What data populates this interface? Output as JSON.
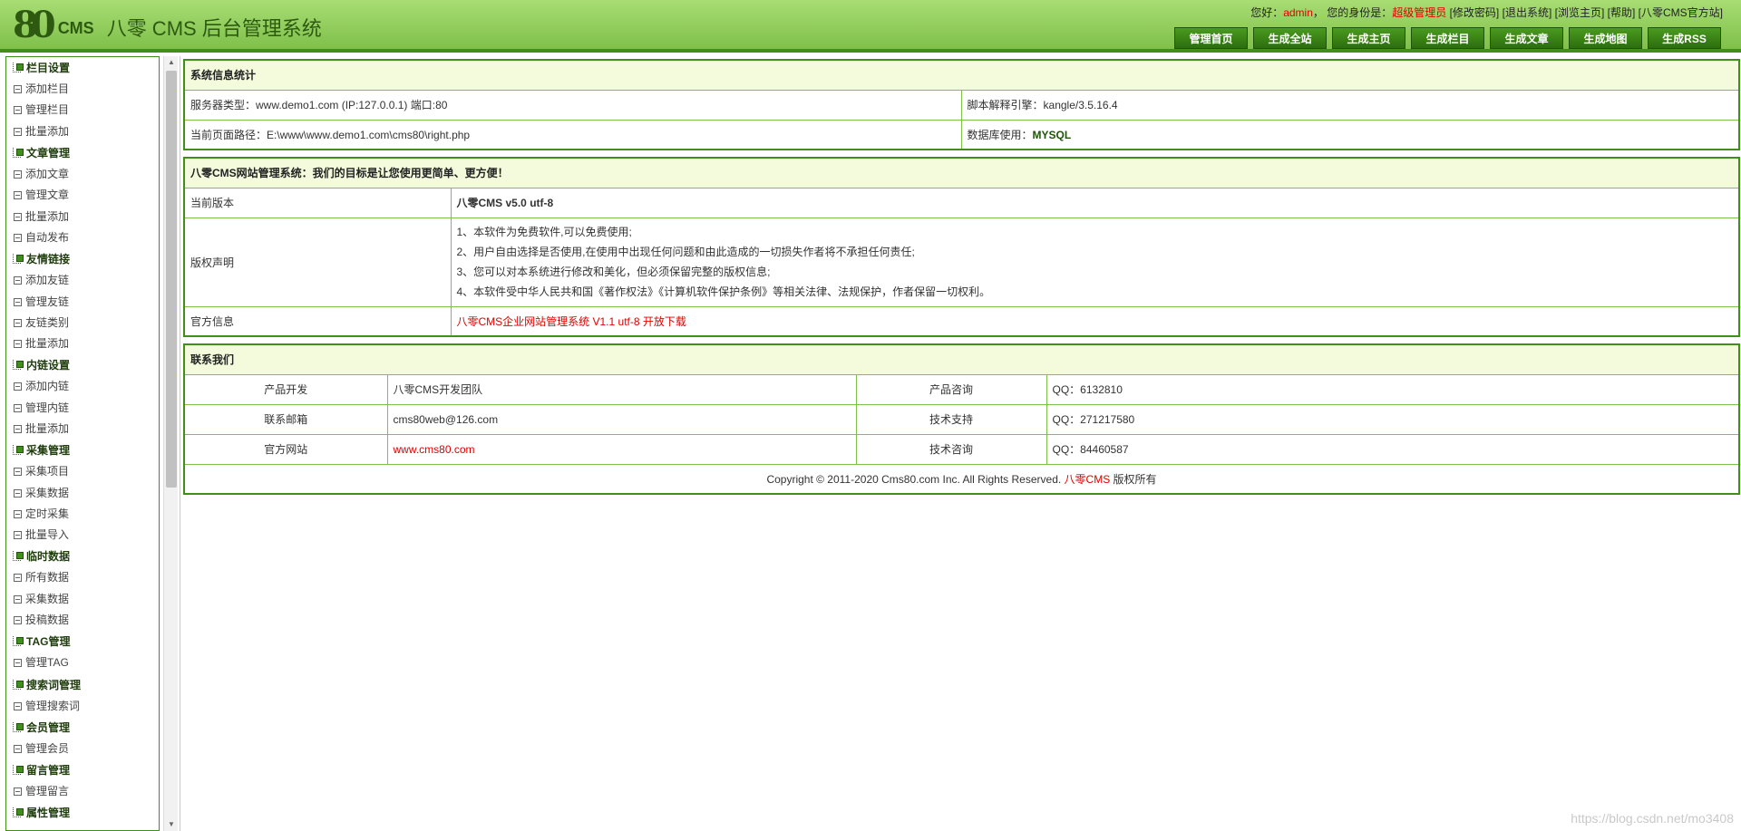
{
  "header": {
    "logo_mark": "8",
    "logo_cms": "CMS",
    "title": "八零 CMS 后台管理系统",
    "greeting": "您好：",
    "username": "admin",
    "identity_label": "，  您的身份是：",
    "role": "超级管理员",
    "links": [
      "[修改密码]",
      "[退出系统]",
      "[浏览主页]",
      "[帮助]",
      "[八零CMS官方站]"
    ],
    "nav": [
      "管理首页",
      "生成全站",
      "生成主页",
      "生成栏目",
      "生成文章",
      "生成地图",
      "生成RSS"
    ]
  },
  "sidebar": [
    {
      "title": "栏目设置",
      "items": [
        "添加栏目",
        "管理栏目",
        "批量添加"
      ]
    },
    {
      "title": "文章管理",
      "items": [
        "添加文章",
        "管理文章",
        "批量添加",
        "自动发布"
      ]
    },
    {
      "title": "友情链接",
      "items": [
        "添加友链",
        "管理友链",
        "友链类别",
        "批量添加"
      ]
    },
    {
      "title": "内链设置",
      "items": [
        "添加内链",
        "管理内链",
        "批量添加"
      ]
    },
    {
      "title": "采集管理",
      "items": [
        "采集项目",
        "采集数据",
        "定时采集",
        "批量导入"
      ]
    },
    {
      "title": "临时数据",
      "items": [
        "所有数据",
        "采集数据",
        "投稿数据"
      ]
    },
    {
      "title": "TAG管理",
      "items": [
        "管理TAG"
      ]
    },
    {
      "title": "搜索词管理",
      "items": [
        "管理搜索词"
      ]
    },
    {
      "title": "会员管理",
      "items": [
        "管理会员"
      ]
    },
    {
      "title": "留言管理",
      "items": [
        "管理留言"
      ]
    },
    {
      "title": "属性管理",
      "items": []
    }
  ],
  "sysinfo": {
    "title": "系统信息统计",
    "server_label": "服务器类型：",
    "server_value": "www.demo1.com (IP:127.0.0.1) 端口:80",
    "engine_label": "脚本解释引擎：",
    "engine_value": "kangle/3.5.16.4",
    "path_label": "当前页面路径：",
    "path_value": "E:\\www\\www.demo1.com\\cms80\\right.php",
    "db_label": "数据库使用：",
    "db_value": "MYSQL"
  },
  "about": {
    "title": "八零CMS网站管理系统：我们的目标是让您使用更简单、更方便！",
    "version_label": "当前版本",
    "version_value": "八零CMS v5.0 utf-8",
    "copyright_label": "版权声明",
    "copyright_lines": [
      "1、本软件为免费软件,可以免费使用;",
      "2、用户自由选择是否使用,在使用中出现任何问题和由此造成的一切损失作者将不承担任何责任;",
      "3、您可以对本系统进行修改和美化，但必须保留完整的版权信息;",
      "4、本软件受中华人民共和国《著作权法》《计算机软件保护条例》等相关法律、法规保护，作者保留一切权利。"
    ],
    "official_label": "官方信息",
    "official_value": "八零CMS企业网站管理系统 V1.1 utf-8 开放下载"
  },
  "contact": {
    "title": "联系我们",
    "rows": [
      {
        "l1": "产品开发",
        "v1": "八零CMS开发团队",
        "l2": "产品咨询",
        "v2": "QQ：6132810"
      },
      {
        "l1": "联系邮箱",
        "v1": "cms80web@126.com",
        "l2": "技术支持",
        "v2": "QQ：271217580"
      },
      {
        "l1": "官方网站",
        "v1": "www.cms80.com",
        "l2": "技术咨询",
        "v2": "QQ：84460587"
      }
    ],
    "footer_prefix": "Copyright © 2011-2020 Cms80.com Inc. All Rights Reserved. ",
    "footer_brand": "八零CMS",
    "footer_suffix": " 版权所有"
  },
  "watermark": "https://blog.csdn.net/mo3408"
}
